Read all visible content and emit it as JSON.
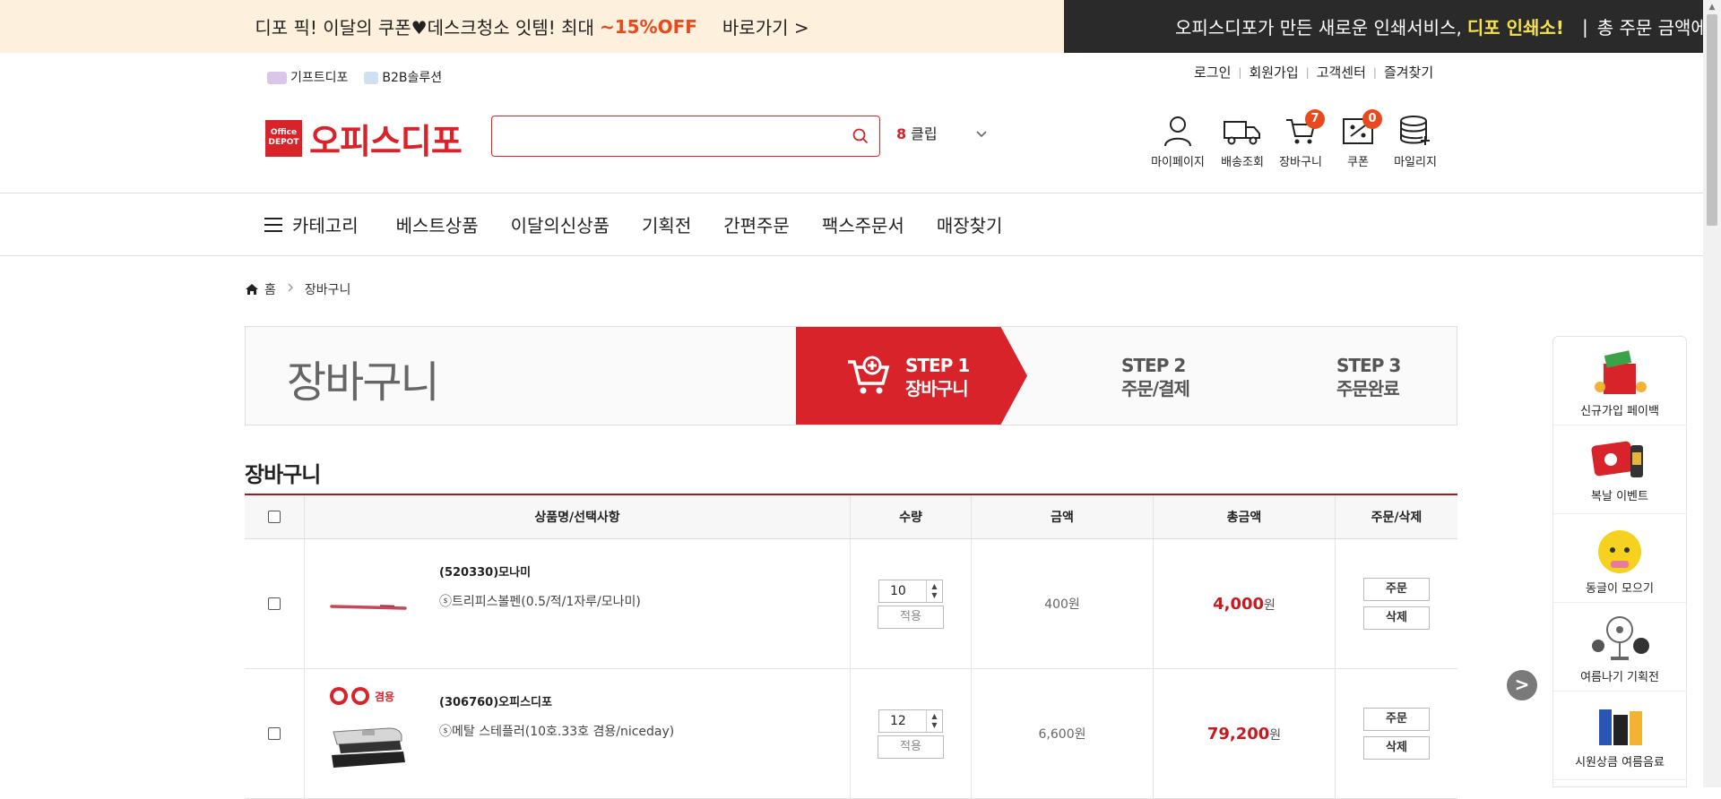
{
  "banner": {
    "left_text": "디포 픽! 이달의 쿠폰♥데스크청소 잇템! 최대",
    "left_accent": "~15%OFF",
    "left_go": "바로가기 >",
    "right_text": "오피스디포가 만든 새로운 인쇄서비스,",
    "right_highlight": "디포 인쇄소!",
    "right_sep": "|",
    "right_tail": "총 주문 금액에 따",
    "accent_color": "#e8491d",
    "highlight_color": "#f6e34c"
  },
  "util": {
    "left": [
      "기프트디포",
      "B2B솔루션"
    ],
    "right": [
      "로그인",
      "회원가입",
      "고객센터",
      "즐겨찾기"
    ],
    "separator": "|"
  },
  "logo": {
    "box_line1": "Office",
    "box_line2": "DEPOT",
    "name": "오피스디포",
    "brand_color": "#d8232a"
  },
  "search": {
    "value": "",
    "placeholder": ""
  },
  "clip": {
    "count": "8",
    "label": "클립"
  },
  "header_icons": [
    {
      "label": "마이페이지",
      "icon": "person-icon"
    },
    {
      "label": "배송조회",
      "icon": "truck-icon"
    },
    {
      "label": "장바구니",
      "icon": "cart-icon",
      "badge": "7"
    },
    {
      "label": "쿠폰",
      "icon": "coupon-icon",
      "badge": "0"
    },
    {
      "label": "마일리지",
      "icon": "coins-icon"
    }
  ],
  "nav": {
    "category": "카테고리",
    "items": [
      "베스트상품",
      "이달의신상품",
      "기획전",
      "간편주문",
      "팩스주문서",
      "매장찾기"
    ]
  },
  "breadcrumb": {
    "home": "홈",
    "current": "장바구니"
  },
  "steps": {
    "title": "장바구니",
    "step1_num": "STEP 1",
    "step1_label": "장바구니",
    "step2_num": "STEP 2",
    "step2_label": "주문/결제",
    "step3_num": "STEP 3",
    "step3_label": "주문완료"
  },
  "cart": {
    "title": "장바구니",
    "columns": [
      "상품명/선택사항",
      "수량",
      "금액",
      "총금액",
      "주문/삭제"
    ],
    "apply_label": "적용",
    "order_label": "주문",
    "delete_label": "삭제",
    "won": "원",
    "rows": [
      {
        "code": "(520330)모나미",
        "name": "ⓢ트리피스볼펜(0.5/적/1자루/모나미)",
        "qty": "10",
        "price": "400원",
        "total": "4,000"
      },
      {
        "code": "(306760)오피스디포",
        "name": "ⓢ메탈 스테플러(10호.33호 겸용/niceday)",
        "qty": "12",
        "price": "6,600원",
        "total": "79,200",
        "img_tag": "겸용"
      }
    ]
  },
  "side_banner": [
    {
      "label": "신규가입 페이백"
    },
    {
      "label": "복날 이벤트"
    },
    {
      "label": "동글이 모으기"
    },
    {
      "label": "여름나기 기획전"
    },
    {
      "label": "시원상큼 여름음료"
    }
  ],
  "side_arrow": ">"
}
